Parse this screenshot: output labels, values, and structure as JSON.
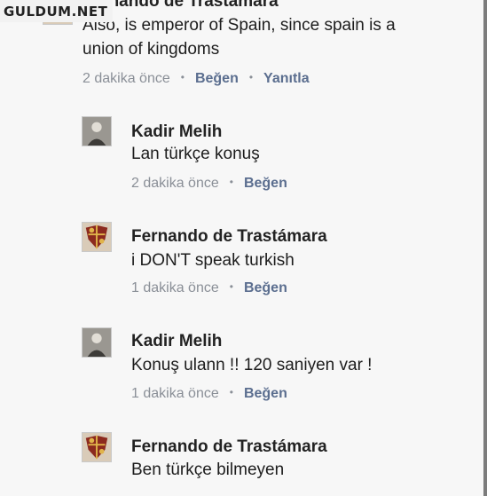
{
  "watermark": "GULDUM.NET",
  "comments": [
    {
      "author": "Fernando de Trastámara",
      "lines": [
        "Also, is emperor of Spain, since spain is a",
        "union of kingdoms"
      ],
      "time": "2 dakika önce",
      "like": "Beğen",
      "reply": "Yanıtla",
      "avatar_icon": "coat-of-arms-icon"
    },
    {
      "author": "Kadir Melih",
      "lines": [
        "Lan türkçe konuş"
      ],
      "time": "2 dakika önce",
      "like": "Beğen",
      "avatar_icon": "person-icon"
    },
    {
      "author": "Fernando de Trastámara",
      "lines": [
        "i DON'T speak turkish"
      ],
      "time": "1 dakika önce",
      "like": "Beğen",
      "avatar_icon": "coat-of-arms-icon"
    },
    {
      "author": "Kadir Melih",
      "lines": [
        "Konuş ulann !! 120 saniyen var !"
      ],
      "time": "1 dakika önce",
      "like": "Beğen",
      "avatar_icon": "person-icon"
    },
    {
      "author": "Fernando de Trastámara",
      "lines": [
        "Ben türkçe bilmeyen"
      ],
      "avatar_icon": "coat-of-arms-icon"
    }
  ],
  "colors": {
    "background": "#f7f7f7",
    "name": "#222222",
    "meta": "#8a8f97",
    "action": "#5b6e8f"
  }
}
